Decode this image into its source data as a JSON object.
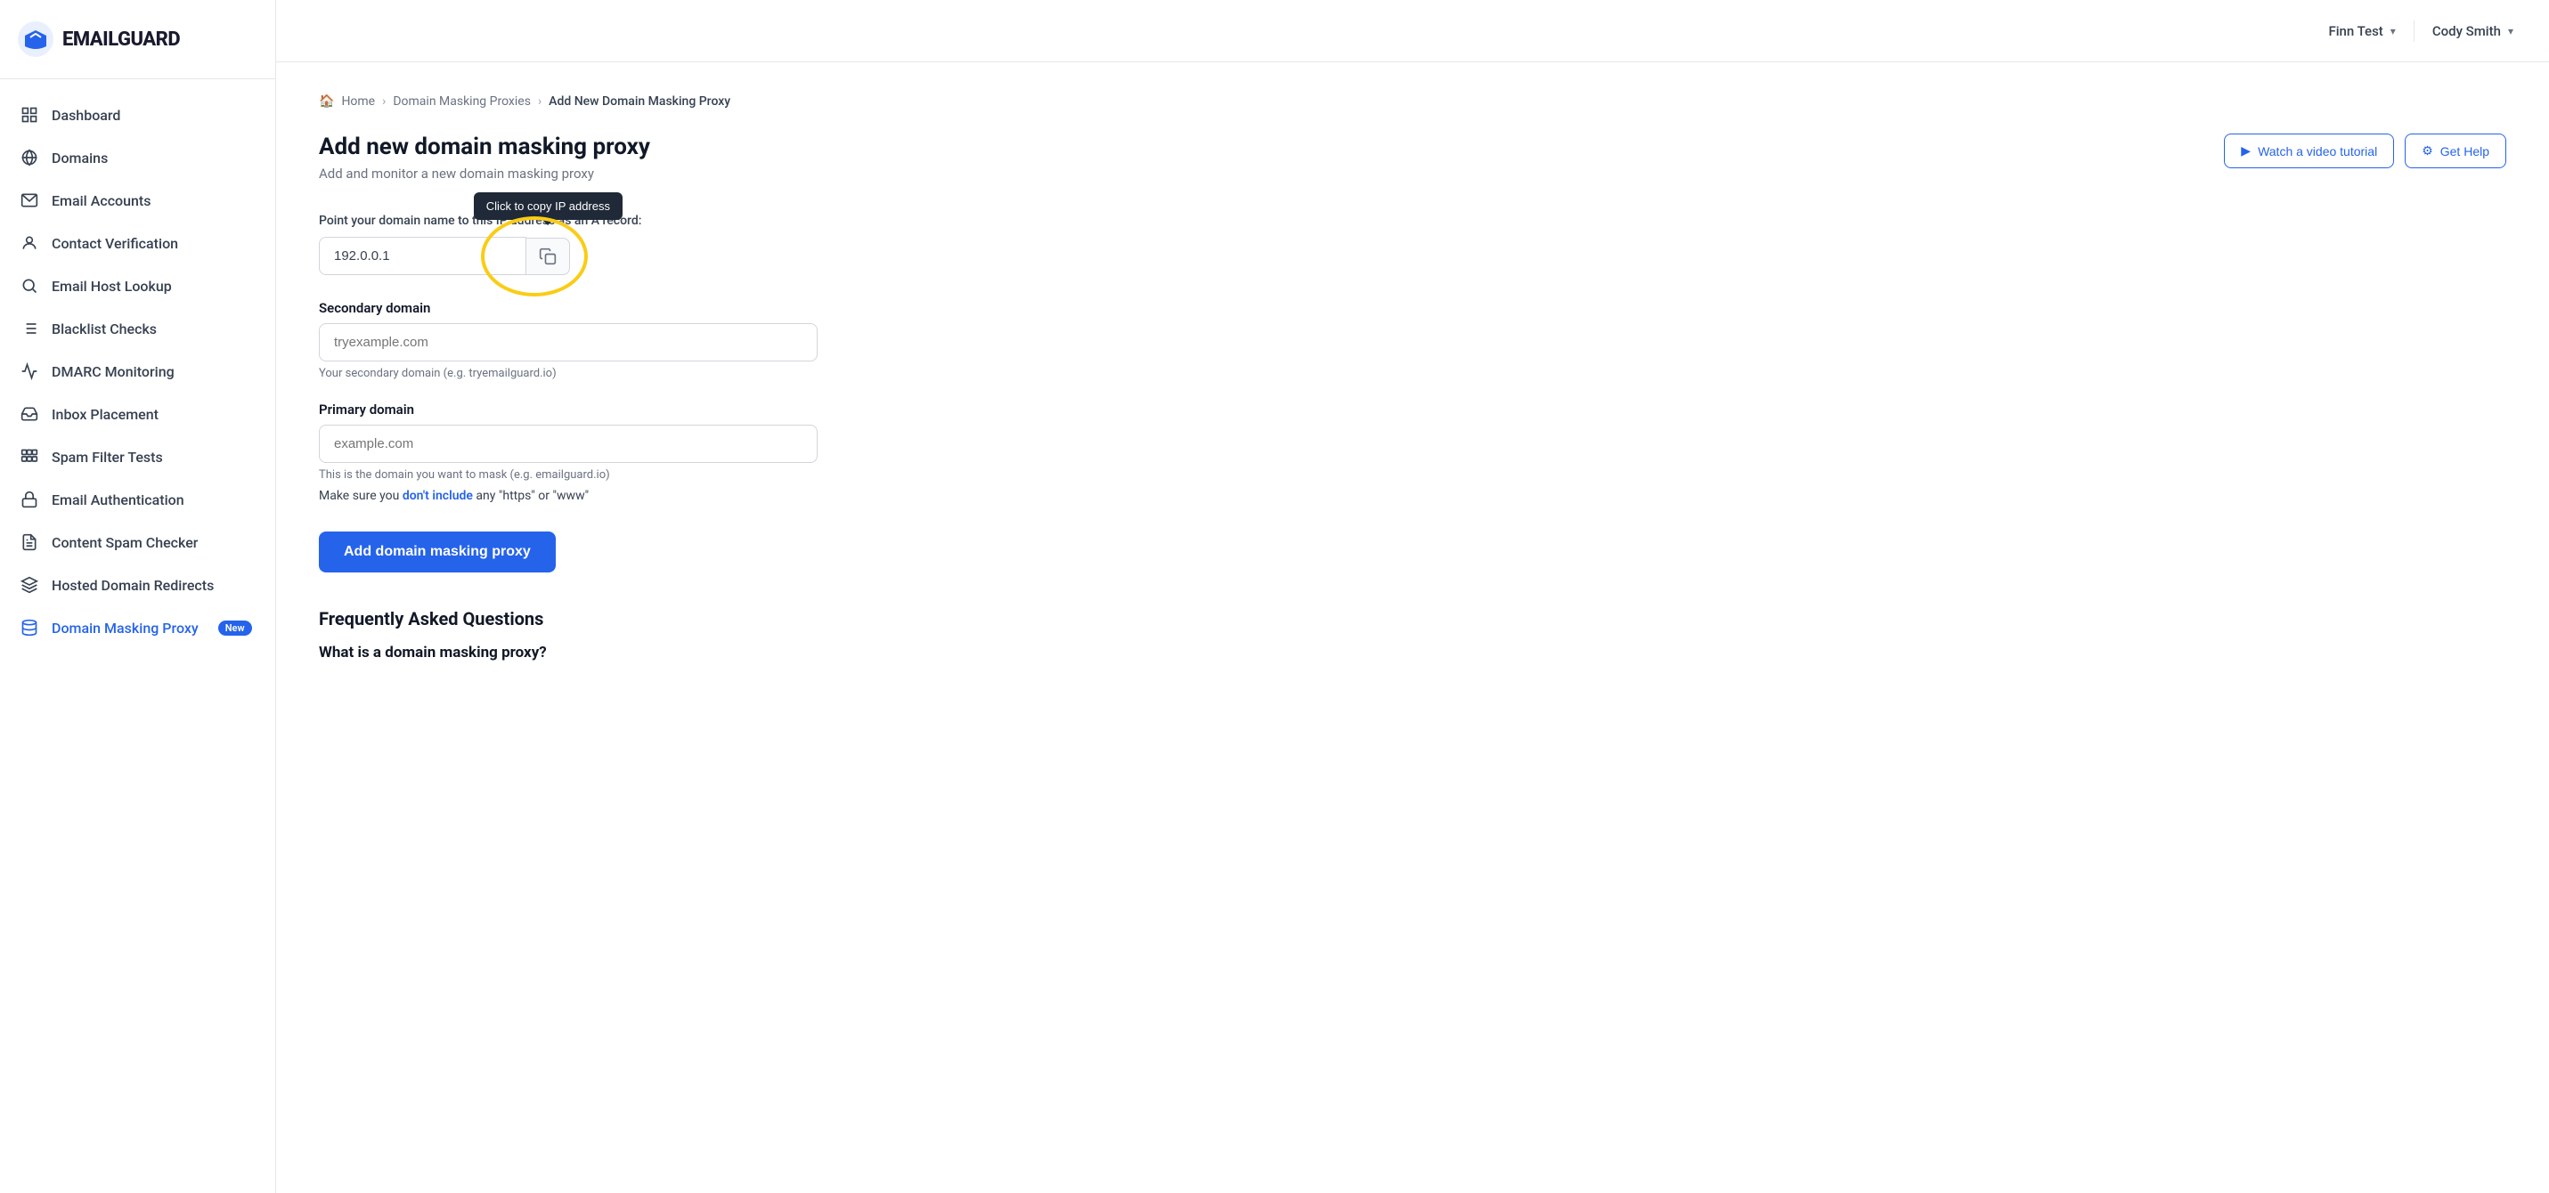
{
  "app": {
    "logo_text": "EMAILGUARD",
    "logo_icon": "bird"
  },
  "header": {
    "user1_label": "Finn Test",
    "user2_label": "Cody Smith"
  },
  "sidebar": {
    "items": [
      {
        "id": "dashboard",
        "label": "Dashboard",
        "icon": "grid"
      },
      {
        "id": "domains",
        "label": "Domains",
        "icon": "globe"
      },
      {
        "id": "email-accounts",
        "label": "Email Accounts",
        "icon": "mail"
      },
      {
        "id": "contact-verification",
        "label": "Contact Verification",
        "icon": "user"
      },
      {
        "id": "email-host-lookup",
        "label": "Email Host Lookup",
        "icon": "search"
      },
      {
        "id": "blacklist-checks",
        "label": "Blacklist Checks",
        "icon": "list"
      },
      {
        "id": "dmarc-monitoring",
        "label": "DMARC Monitoring",
        "icon": "activity"
      },
      {
        "id": "inbox-placement",
        "label": "Inbox Placement",
        "icon": "inbox"
      },
      {
        "id": "spam-filter-tests",
        "label": "Spam Filter Tests",
        "icon": "filter"
      },
      {
        "id": "email-authentication",
        "label": "Email Authentication",
        "icon": "lock"
      },
      {
        "id": "content-spam-checker",
        "label": "Content Spam Checker",
        "icon": "file"
      },
      {
        "id": "hosted-domain-redirects",
        "label": "Hosted Domain Redirects",
        "icon": "layers"
      },
      {
        "id": "domain-masking-proxy",
        "label": "Domain Masking Proxy",
        "icon": "database",
        "badge": "New",
        "active": true
      }
    ]
  },
  "breadcrumb": {
    "home": "Home",
    "parent": "Domain Masking Proxies",
    "current": "Add New Domain Masking Proxy"
  },
  "page": {
    "title": "Add new domain masking proxy",
    "subtitle": "Add and monitor a new domain masking proxy",
    "watch_label": "Watch a video tutorial",
    "help_label": "Get Help"
  },
  "form": {
    "ip_label": "Point your domain name to this IP address as an A record:",
    "ip_value": "192.0.0.1",
    "copy_tooltip": "Click to copy IP address",
    "secondary_label": "Secondary domain",
    "secondary_placeholder": "tryexample.com",
    "secondary_hint": "Your secondary domain (e.g. tryemailguard.io)",
    "primary_label": "Primary domain",
    "primary_placeholder": "example.com",
    "primary_hint": "This is the domain you want to mask (e.g. emailguard.io)",
    "warning_line": "Make sure you don't include any \"https\" or \"www\"",
    "warning_bold": "don't include",
    "submit_label": "Add domain masking proxy"
  },
  "faq": {
    "title": "Frequently Asked Questions",
    "q1": "What is a domain masking proxy?"
  }
}
